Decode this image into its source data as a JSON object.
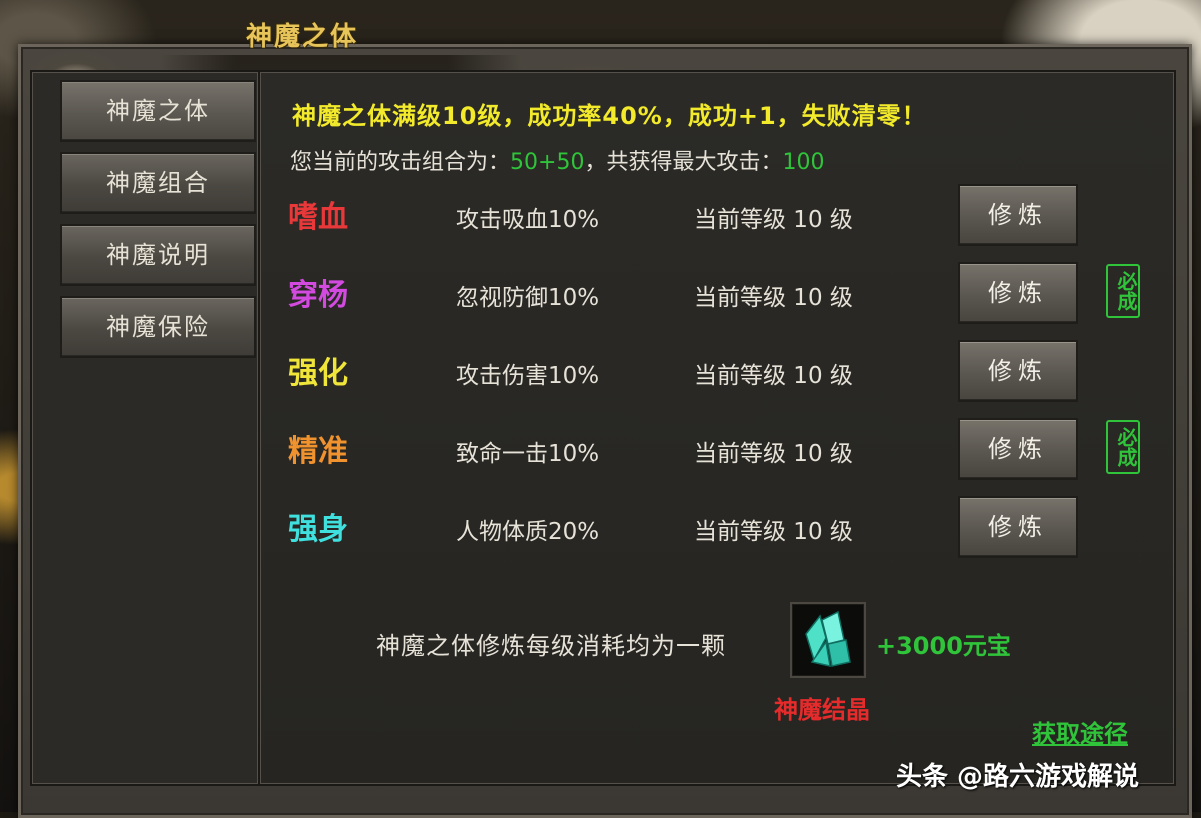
{
  "window": {
    "title": "神魔之体"
  },
  "sidebar": {
    "items": [
      {
        "label": "神魔之体"
      },
      {
        "label": "神魔组合"
      },
      {
        "label": "神魔说明"
      },
      {
        "label": "神魔保险"
      }
    ]
  },
  "main": {
    "headline": "神魔之体满级10级，成功率40%，成功+1，失败清零！",
    "combo_prefix": "您当前的攻击组合为：",
    "combo_value": "50+50",
    "combo_middle": "，共获得最大攻击：",
    "combo_max": "100",
    "stats": [
      {
        "name": "嗜血",
        "color": "#e8383a",
        "effect": "攻击吸血10%",
        "level": "当前等级 10 级",
        "button": "修炼",
        "badge": ""
      },
      {
        "name": "穿杨",
        "color": "#d24ae0",
        "effect": "忽视防御10%",
        "level": "当前等级 10 级",
        "button": "修炼",
        "badge": "必成"
      },
      {
        "name": "强化",
        "color": "#f0e63a",
        "effect": "攻击伤害10%",
        "level": "当前等级 10 级",
        "button": "修炼",
        "badge": ""
      },
      {
        "name": "精准",
        "color": "#f0922e",
        "effect": "致命一击10%",
        "level": "当前等级 10 级",
        "button": "修炼",
        "badge": "必成"
      },
      {
        "name": "强身",
        "color": "#3fe0de",
        "effect": "人物体质20%",
        "level": "当前等级 10 级",
        "button": "修炼",
        "badge": ""
      }
    ],
    "cost_text": "神魔之体修炼每级消耗均为一颗",
    "cost_extra": "+3000元宝",
    "item_name": "神魔结晶",
    "item_icon": "crystal-icon",
    "obtain_link": "获取途径"
  },
  "watermark": "头条 @路六游戏解说"
}
